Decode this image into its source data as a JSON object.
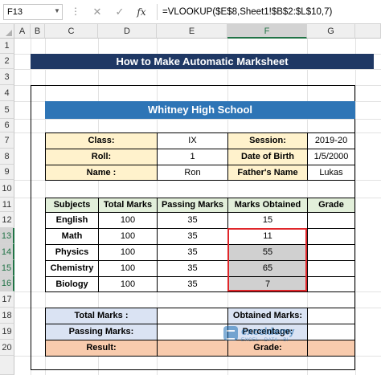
{
  "formula_bar": {
    "name_box": "F13",
    "cancel_icon": "✕",
    "enter_icon": "✓",
    "fx": "fx",
    "formula": "=VLOOKUP($E$8,Sheet1!$B$2:$L$10,7)"
  },
  "columns": [
    "A",
    "B",
    "C",
    "D",
    "E",
    "F",
    "G"
  ],
  "selected_column": "F",
  "rows": [
    "1",
    "2",
    "3",
    "4",
    "5",
    "6",
    "7",
    "8",
    "9",
    "10",
    "11",
    "12",
    "13",
    "14",
    "15",
    "16",
    "17",
    "18",
    "19",
    "20"
  ],
  "selected_rows": [
    "13",
    "14",
    "15",
    "16"
  ],
  "sheet": {
    "title": "How to Make Automatic Marksheet",
    "school": "Whitney High School",
    "info": {
      "class_label": "Class:",
      "class_value": "IX",
      "session_label": "Session:",
      "session_value": "2019-20",
      "roll_label": "Roll:",
      "roll_value": "1",
      "dob_label": "Date of Birth",
      "dob_value": "1/5/2000",
      "name_label": "Name :",
      "name_value": "Ron",
      "father_label": "Father's Name",
      "father_value": "Lukas"
    },
    "table": {
      "headers": [
        "Subjects",
        "Total Marks",
        "Passing Marks",
        "Marks Obtained",
        "Grade"
      ],
      "rows": [
        [
          "English",
          "100",
          "35",
          "15",
          ""
        ],
        [
          "Math",
          "100",
          "35",
          "11",
          ""
        ],
        [
          "Physics",
          "100",
          "35",
          "55",
          ""
        ],
        [
          "Chemistry",
          "100",
          "35",
          "65",
          ""
        ],
        [
          "Biology",
          "100",
          "35",
          "7",
          ""
        ]
      ]
    },
    "summary": {
      "total_label": "Total Marks :",
      "obtained_label": "Obtained Marks:",
      "passing_label": "Passing Marks:",
      "percentage_label": "Percentage:",
      "result_label": "Result:",
      "grade_label": "Grade:"
    }
  },
  "watermark": {
    "name": "exceldemy",
    "sub": "EXCEL · DATA · BI"
  },
  "colors": {
    "title_bg": "#1f3864",
    "school_bg": "#2e75b6",
    "info_bg": "#fff2cc",
    "header_bg": "#e2efda",
    "summary_bg": "#dae3f3",
    "result_bg": "#f8cbad",
    "selection_border": "#e0262a",
    "excel_green": "#217346"
  }
}
